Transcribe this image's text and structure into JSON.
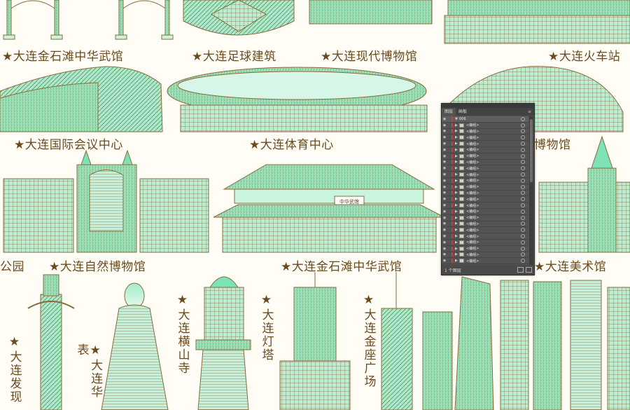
{
  "labels": {
    "jinshitan_top": "★大连金石滩中华武馆",
    "stadium_football": "★大连足球建筑",
    "modern_museum": "★大连现代博物馆",
    "railway": "★大连火车站",
    "conference": "★大连国际会议中心",
    "sports_center": "★大连体育中心",
    "museum_partial": "博物馆",
    "park_partial": "公园",
    "natural_museum": "★大连自然博物馆",
    "jinshitan_mid": "★大连金石滩中华武馆",
    "art_museum": "★大连美术馆",
    "hengshan": "★大连横山寺",
    "lighthouse": "★大连灯塔",
    "jinzuo": "★大连金座广场",
    "faxian": "★大连发现",
    "huabiao": "★大连华表"
  },
  "hall_plaque": "中华武馆",
  "layers_panel": {
    "tabs": [
      "图层",
      "画板"
    ],
    "menu_icon": "≡",
    "group_layer": "006",
    "item_name": "<编组>",
    "items_count": 24,
    "footer_text": "1 个图层",
    "colors": {
      "bg": "#535353",
      "accent": "#d23b3b"
    }
  },
  "colors": {
    "mint": "#7de3b4",
    "bronze": "#8a6a3a",
    "text": "#6b4a1e",
    "background": "#fffdf6"
  },
  "icons": [
    "eye-icon",
    "expand-triangle-icon",
    "target-circle-icon",
    "new-layer-icon",
    "delete-icon"
  ]
}
